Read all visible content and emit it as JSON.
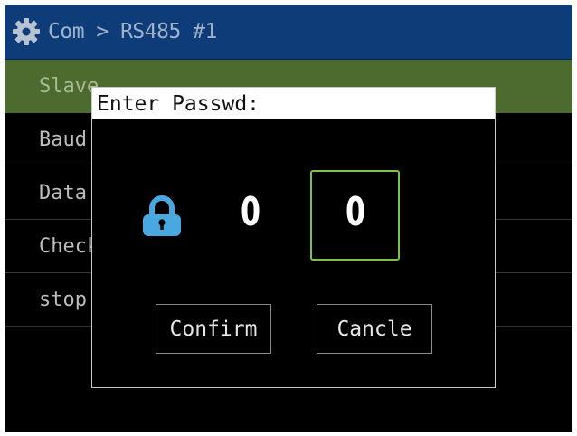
{
  "colors": {
    "titlebar_bg": "#0e3c78",
    "selected_row_bg": "#4d6b2e",
    "focus_border": "#7cc246",
    "lock_icon": "#4aa8e0"
  },
  "header": {
    "icon": "gear-icon",
    "breadcrumb": "Com > RS485 #1"
  },
  "menu": {
    "selected_index": 0,
    "items": [
      {
        "label": "Slave"
      },
      {
        "label": "Baud"
      },
      {
        "label": "Data"
      },
      {
        "label": "Check"
      },
      {
        "label": "stop"
      }
    ]
  },
  "dialog": {
    "title": "Enter Passwd:",
    "icon": "lock-icon",
    "digits": [
      "0",
      "0"
    ],
    "focused_digit_index": 1,
    "confirm_label": "Confirm",
    "cancel_label": "Cancle"
  }
}
